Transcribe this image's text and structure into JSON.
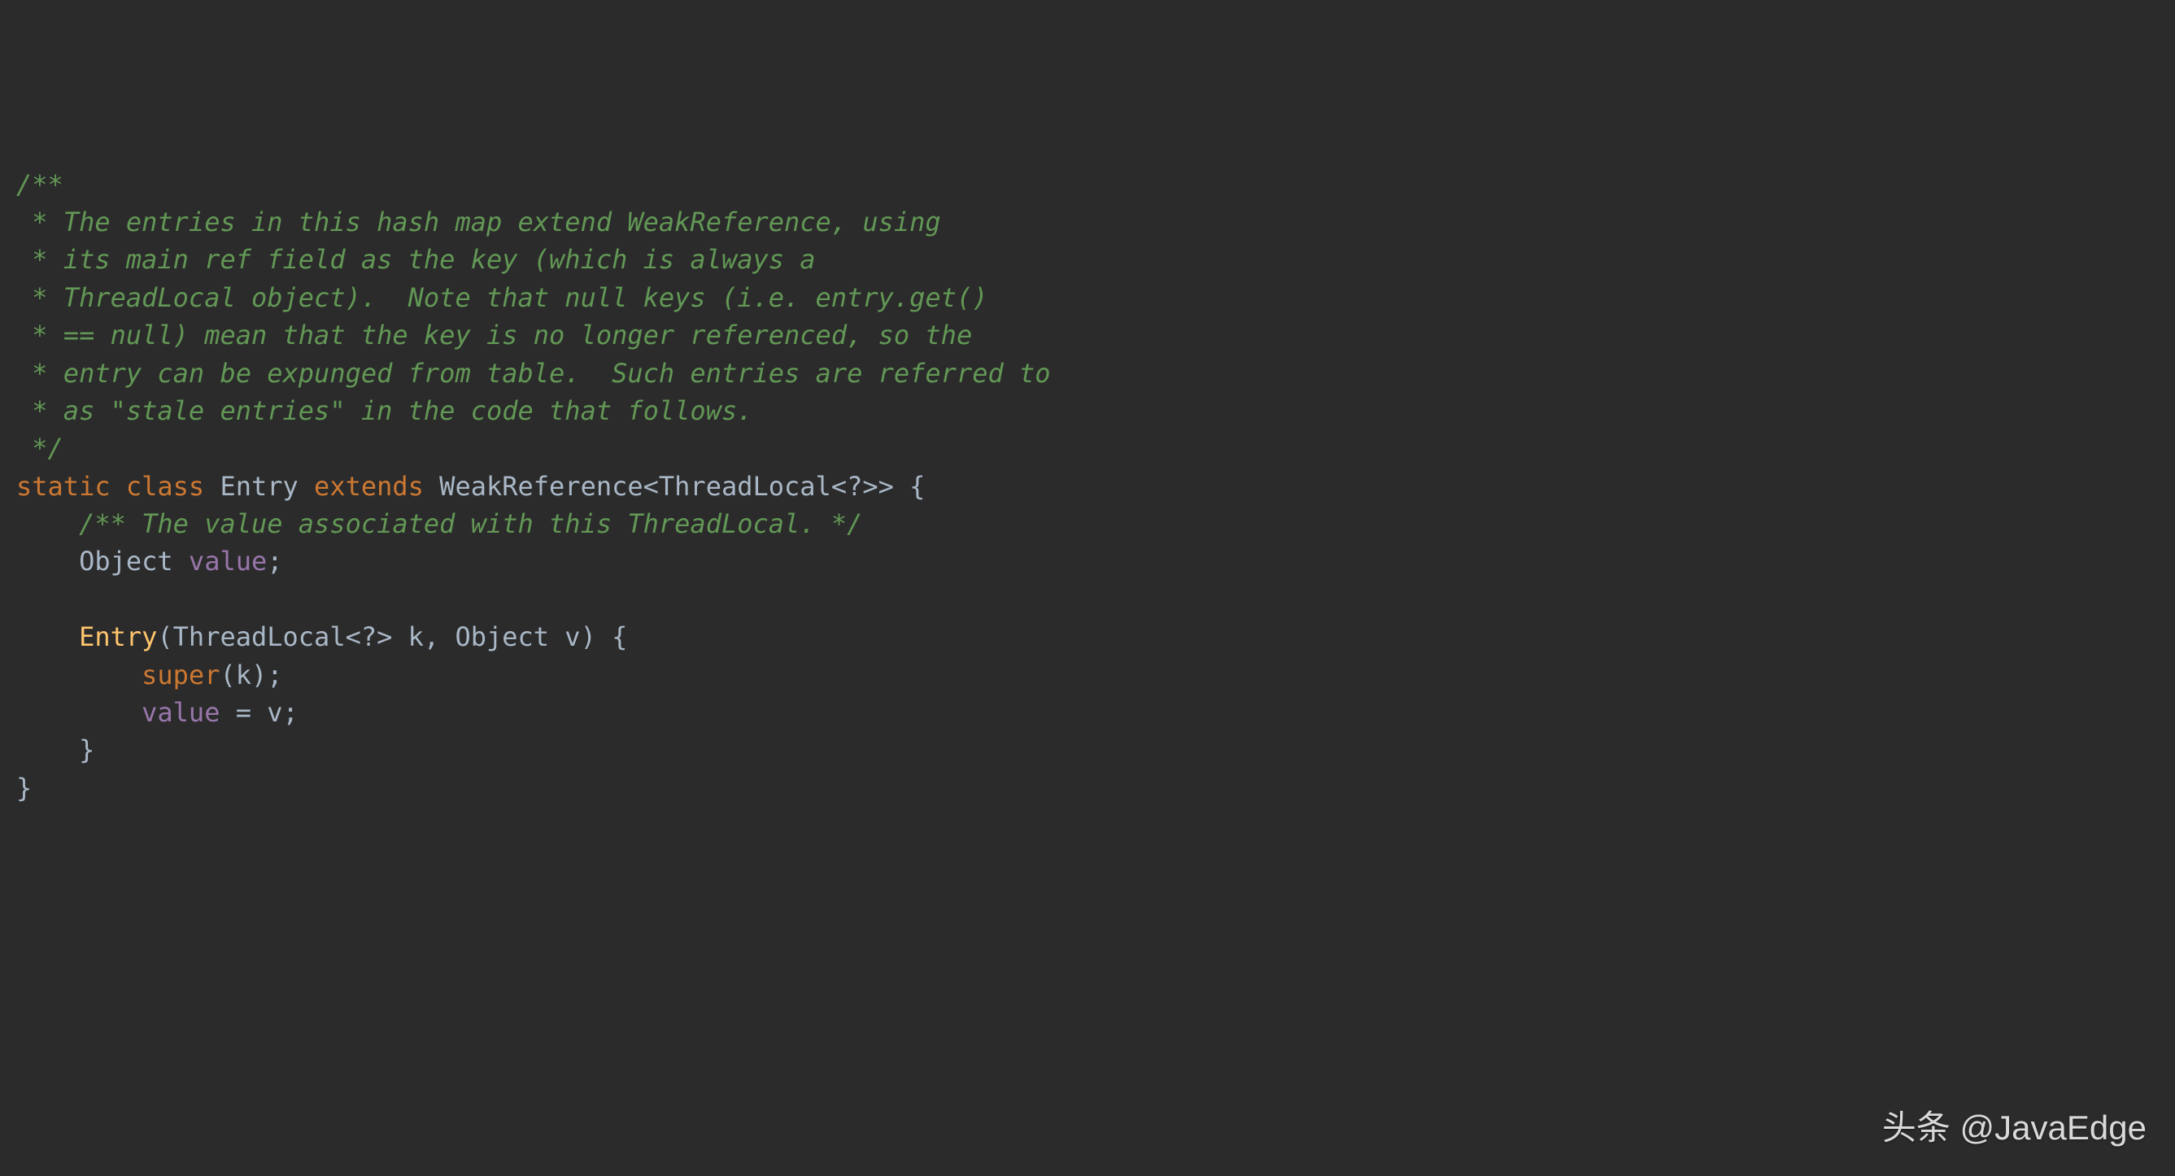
{
  "code": {
    "c1": "/**",
    "c2": " * The entries in this hash map extend WeakReference, using",
    "c3": " * its main ref field as the key (which is always a",
    "c4": " * ThreadLocal object).  Note that null keys (i.e. entry.get()",
    "c5": " * == null) mean that the key is no longer referenced, so the",
    "c6": " * entry can be expunged from table.  Such entries are referred to",
    "c7": " * as \"stale entries\" in the code that follows.",
    "c8": " */",
    "kw_static": "static",
    "kw_class": "class",
    "cls_entry": "Entry",
    "kw_extends": "extends",
    "cls_weakref": "WeakReference",
    "lt1": "<",
    "cls_threadlocal": "ThreadLocal",
    "lt2": "<",
    "wildcard": "?",
    "gt2": ">",
    "gt1": ">",
    "brace_open": " {",
    "c9": "/** The value associated with this ThreadLocal. */",
    "type_object": "Object",
    "field_value": "value",
    "semicolon": ";",
    "ctor_name": "Entry",
    "paren_open": "(",
    "param1_type": "ThreadLocal",
    "param1_lt": "<",
    "param1_wild": "?",
    "param1_gt": ">",
    "param1_name": " k",
    "comma": ",",
    "param2_type": " Object",
    "param2_name": " v",
    "paren_close": ")",
    "ctor_brace": " {",
    "kw_super": "super",
    "super_paren_open": "(",
    "super_arg": "k",
    "super_paren_close": ")",
    "super_semi": ";",
    "assign_lhs": "value",
    "assign_eq": " = ",
    "assign_rhs": "v",
    "assign_semi": ";",
    "ctor_close": "}",
    "class_close": "}"
  },
  "watermark": "头条 @JavaEdge"
}
